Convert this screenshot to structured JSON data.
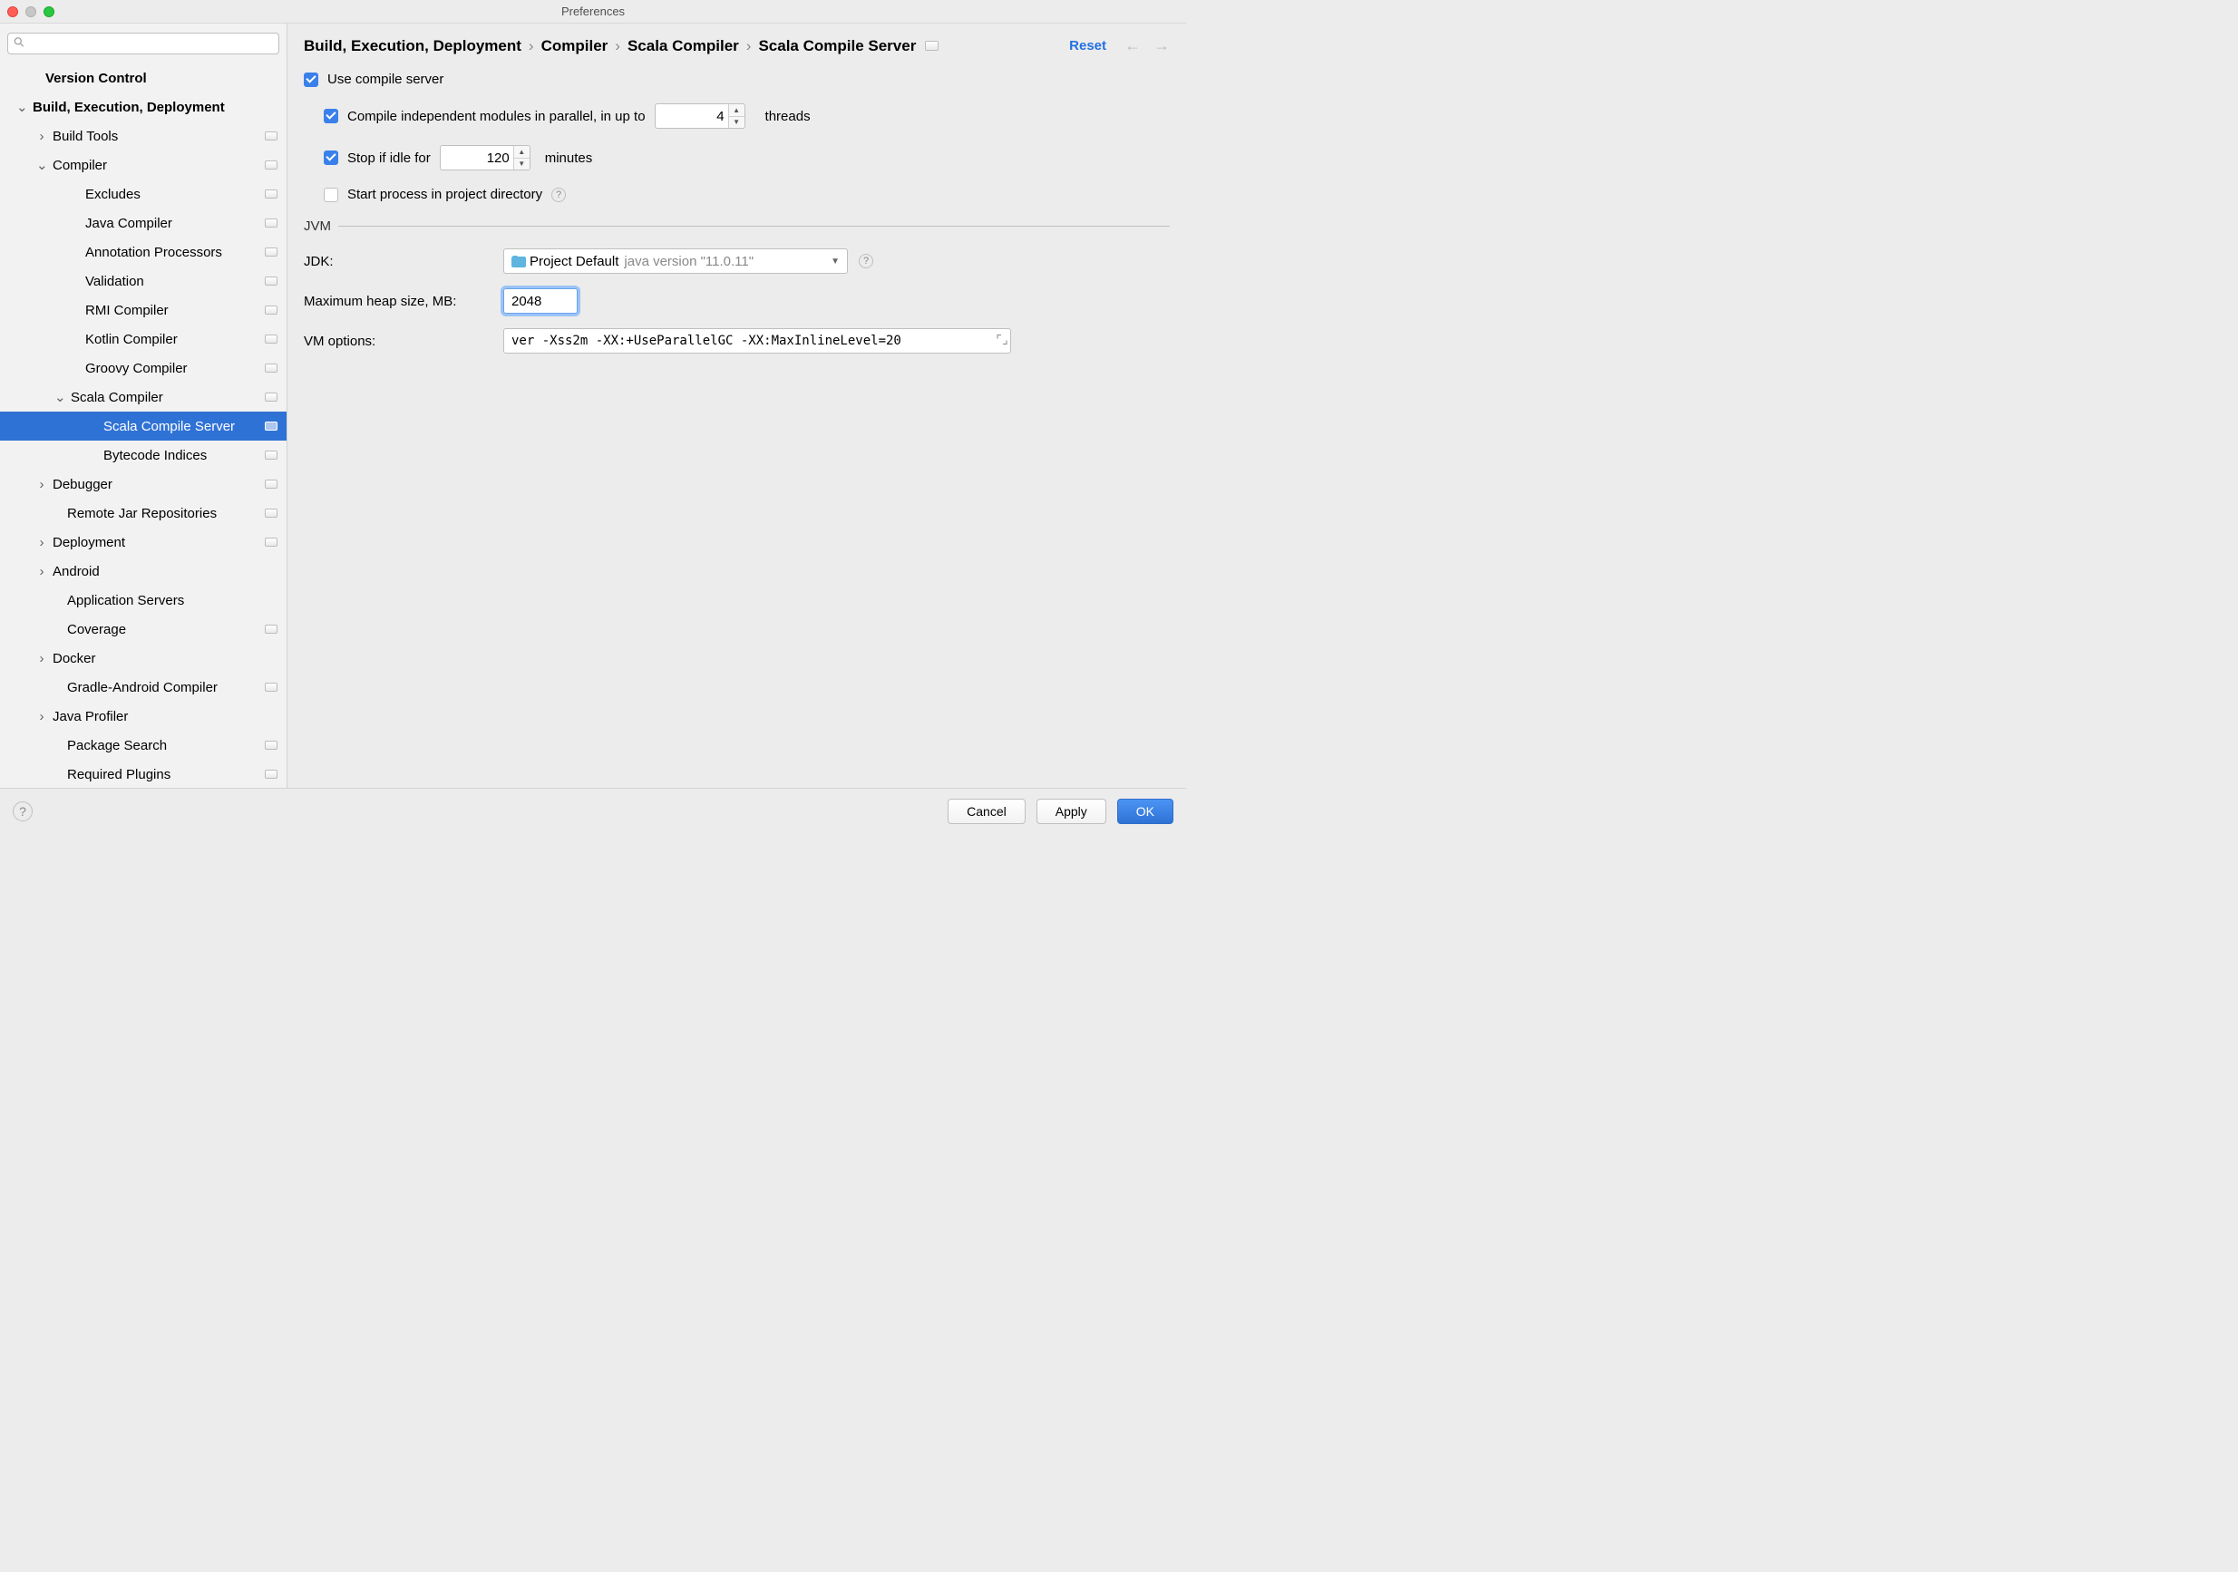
{
  "window": {
    "title": "Preferences"
  },
  "search": {
    "placeholder": ""
  },
  "sidebar": [
    {
      "label": "Version Control",
      "indent": 32,
      "bold": true,
      "chev": "",
      "pin": false
    },
    {
      "label": "Build, Execution, Deployment",
      "indent": 18,
      "bold": true,
      "chev": "⌄",
      "pin": false
    },
    {
      "label": "Build Tools",
      "indent": 40,
      "chev": "›",
      "pin": true
    },
    {
      "label": "Compiler",
      "indent": 40,
      "chev": "⌄",
      "pin": true
    },
    {
      "label": "Excludes",
      "indent": 76,
      "chev": "",
      "pin": true
    },
    {
      "label": "Java Compiler",
      "indent": 76,
      "chev": "",
      "pin": true
    },
    {
      "label": "Annotation Processors",
      "indent": 76,
      "chev": "",
      "pin": true
    },
    {
      "label": "Validation",
      "indent": 76,
      "chev": "",
      "pin": true
    },
    {
      "label": "RMI Compiler",
      "indent": 76,
      "chev": "",
      "pin": true
    },
    {
      "label": "Kotlin Compiler",
      "indent": 76,
      "chev": "",
      "pin": true
    },
    {
      "label": "Groovy Compiler",
      "indent": 76,
      "chev": "",
      "pin": true
    },
    {
      "label": "Scala Compiler",
      "indent": 60,
      "chev": "⌄",
      "pin": true
    },
    {
      "label": "Scala Compile Server",
      "indent": 96,
      "chev": "",
      "pin": true,
      "selected": true
    },
    {
      "label": "Bytecode Indices",
      "indent": 96,
      "chev": "",
      "pin": true
    },
    {
      "label": "Debugger",
      "indent": 40,
      "chev": "›",
      "pin": true
    },
    {
      "label": "Remote Jar Repositories",
      "indent": 56,
      "chev": "",
      "pin": true
    },
    {
      "label": "Deployment",
      "indent": 40,
      "chev": "›",
      "pin": true
    },
    {
      "label": "Android",
      "indent": 40,
      "chev": "›",
      "pin": false
    },
    {
      "label": "Application Servers",
      "indent": 56,
      "chev": "",
      "pin": false
    },
    {
      "label": "Coverage",
      "indent": 56,
      "chev": "",
      "pin": true
    },
    {
      "label": "Docker",
      "indent": 40,
      "chev": "›",
      "pin": false
    },
    {
      "label": "Gradle-Android Compiler",
      "indent": 56,
      "chev": "",
      "pin": true
    },
    {
      "label": "Java Profiler",
      "indent": 40,
      "chev": "›",
      "pin": false
    },
    {
      "label": "Package Search",
      "indent": 56,
      "chev": "",
      "pin": true
    },
    {
      "label": "Required Plugins",
      "indent": 56,
      "chev": "",
      "pin": true
    }
  ],
  "breadcrumb": [
    "Build, Execution, Deployment",
    "Compiler",
    "Scala Compiler",
    "Scala Compile Server"
  ],
  "reset_label": "Reset",
  "form": {
    "use_compile_server": {
      "label": "Use compile server",
      "checked": true
    },
    "parallel": {
      "prefix": "Compile independent modules in parallel, in up to",
      "value": "4",
      "suffix": "threads",
      "checked": true
    },
    "idle": {
      "prefix": "Stop if idle for",
      "value": "120",
      "suffix": "minutes",
      "checked": true
    },
    "start_in_project": {
      "label": "Start process in project directory",
      "checked": false
    },
    "fieldset_label": "JVM",
    "jdk": {
      "label": "JDK:",
      "value": "Project Default",
      "version": "java version \"11.0.11\""
    },
    "heap": {
      "label": "Maximum heap size, MB:",
      "value": "2048"
    },
    "vm_options": {
      "label": "VM options:",
      "value": "ver -Xss2m -XX:+UseParallelGC -XX:MaxInlineLevel=20"
    }
  },
  "buttons": {
    "cancel": "Cancel",
    "apply": "Apply",
    "ok": "OK"
  }
}
